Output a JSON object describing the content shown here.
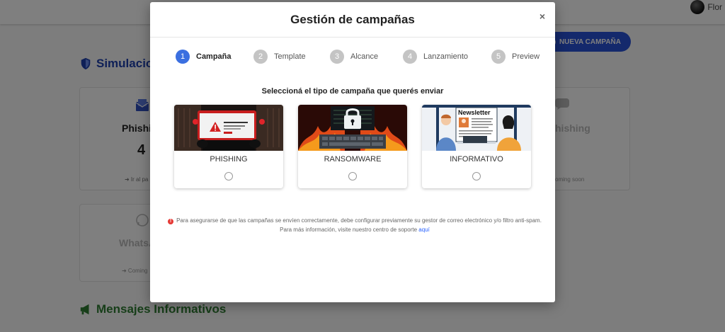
{
  "background": {
    "user_name": "Flor",
    "simulations_title": "Simulacio",
    "new_campaign_label": "NUEVA CAMPAÑA",
    "phishing_card": {
      "label": "Phishi",
      "count": "4",
      "link": "➜ Ir al pa"
    },
    "whatsapp_card": {
      "label": "WhatsA",
      "status": "➜ Coming"
    },
    "sms_card": {
      "label": "hishing",
      "status": "oming soon"
    },
    "messages_title": "Mensajes Informativos"
  },
  "modal": {
    "title": "Gestión de campañas",
    "close_label": "×",
    "steps": [
      {
        "number": "1",
        "label": "Campaña",
        "active": true
      },
      {
        "number": "2",
        "label": "Template",
        "active": false
      },
      {
        "number": "3",
        "label": "Alcance",
        "active": false
      },
      {
        "number": "4",
        "label": "Lanzamiento",
        "active": false
      },
      {
        "number": "5",
        "label": "Preview",
        "active": false
      }
    ],
    "subtitle": "Seleccioná el tipo de campaña que querés enviar",
    "campaign_types": [
      {
        "label": "PHISHING",
        "image": "hacker-laptop-warning-illustration"
      },
      {
        "label": "RANSOMWARE",
        "image": "padlock-flames-keyboard-illustration"
      },
      {
        "label": "INFORMATIVO",
        "image": "newsletter-coworkers-illustration"
      }
    ],
    "newsletter_text": "Newsletter",
    "notice_text": "Para asegurarse de que las campañas se envíen correctamente, debe configurar previamente su gestor de correo electrónico y/o filtro anti-spam. Para más información, visite nuestro centro de soporte",
    "notice_link": "aquí",
    "notice_icon": "exclamation-circle-icon"
  },
  "colors": {
    "primary": "#3b6fe0",
    "button_blue": "#2952d9",
    "section_blue": "#1e40af",
    "section_green": "#2e7d32",
    "notice_red": "#e53935"
  }
}
